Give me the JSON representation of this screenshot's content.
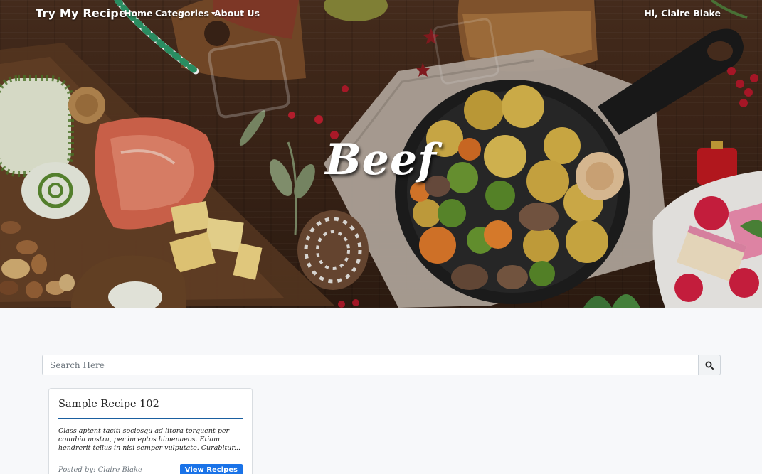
{
  "navbar": {
    "brand": "Try My Recipe",
    "links": [
      {
        "label": "Home"
      },
      {
        "label": "Categories"
      },
      {
        "label": "About Us"
      }
    ],
    "greeting": "Hi, Claire Blake"
  },
  "hero": {
    "title": "Beef"
  },
  "search": {
    "placeholder": "Search Here",
    "value": ""
  },
  "recipes": [
    {
      "title": "Sample Recipe 102",
      "description": "Class aptent taciti sociosqu ad litora torquent per conubia nostra, per inceptos himenaeos. Etiam hendrerit tellus in nisi semper vulputate. Curabitur...",
      "posted_by": "Posted by: Claire Blake",
      "button_label": "View Recipes"
    }
  ],
  "colors": {
    "primary": "#1a73e8",
    "card_divider": "#1a5fa0",
    "page_background": "#f7f8fa"
  },
  "icons": {
    "search": "search-icon",
    "categories_dropdown": "chevron-down-icon"
  }
}
